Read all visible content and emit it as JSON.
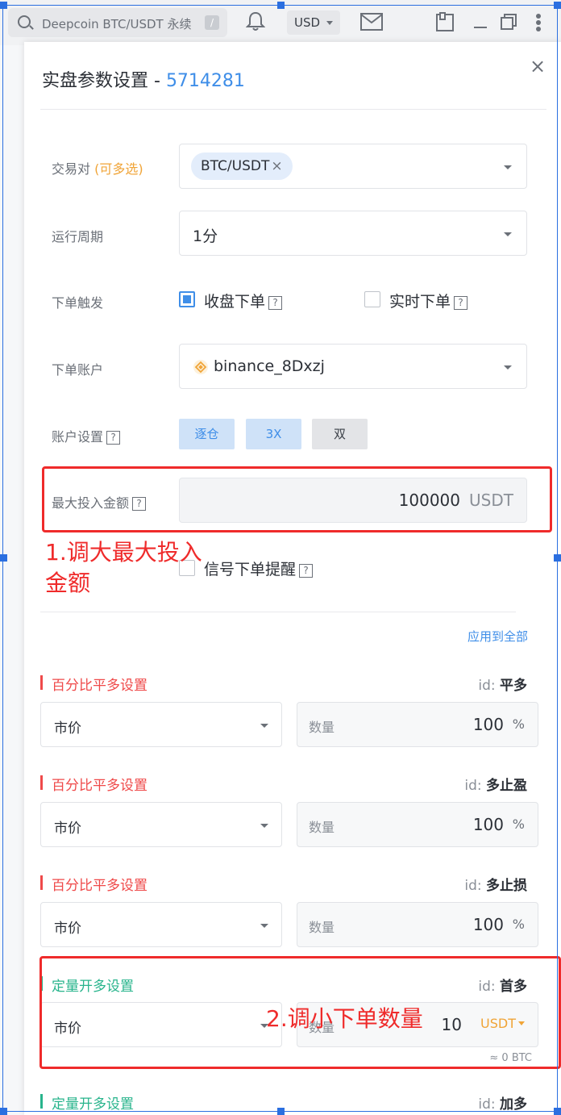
{
  "topbar": {
    "search_text": "Deepcoin BTC/USDT 永续",
    "search_shortcut": "/",
    "currency": "USD"
  },
  "dialog": {
    "title": "实盘参数设置 - ",
    "strategy_id": "5714281",
    "close_label": "×"
  },
  "form": {
    "pair": {
      "label": "交易对 ",
      "hint": "(可多选)",
      "tag": "BTC/USDT",
      "tag_remove": "×"
    },
    "period": {
      "label": "运行周期",
      "value": "1分"
    },
    "trigger": {
      "label": "下单触发",
      "options": [
        {
          "label": "收盘下单",
          "checked": true
        },
        {
          "label": "实时下单",
          "checked": false
        }
      ],
      "help": "?"
    },
    "account": {
      "label": "下单账户",
      "value": "binance_8Dxzj"
    },
    "account_settings": {
      "label": "账户设置",
      "buttons": [
        {
          "label": "逐仓",
          "active": true
        },
        {
          "label": "3X",
          "active": true
        },
        {
          "label": "双",
          "active": false
        }
      ]
    },
    "max_invest": {
      "label": "最大投入金额",
      "value": "100000",
      "unit": "USDT"
    },
    "signal_alert": {
      "label": "信号下单提醒",
      "checked": false
    }
  },
  "annotations": {
    "one_line1": "1.调大最大投入",
    "one_line2": "金额",
    "two": "2.调小下单数量"
  },
  "apply_all": "应用到全部",
  "sections": [
    {
      "title": "百分比平多设置",
      "id_label": "id:",
      "id_value": "平多",
      "order_type": "市价",
      "qty_placeholder": "数量",
      "qty_value": "100",
      "qty_unit": "%",
      "color": "red"
    },
    {
      "title": "百分比平多设置",
      "id_label": "id:",
      "id_value": "多止盈",
      "order_type": "市价",
      "qty_placeholder": "数量",
      "qty_value": "100",
      "qty_unit": "%",
      "color": "red"
    },
    {
      "title": "百分比平多设置",
      "id_label": "id:",
      "id_value": "多止损",
      "order_type": "市价",
      "qty_placeholder": "数量",
      "qty_value": "100",
      "qty_unit": "%",
      "color": "red"
    },
    {
      "title": "定量开多设置",
      "id_label": "id:",
      "id_value": "首多",
      "order_type": "市价",
      "qty_placeholder": "数量",
      "qty_value": "10",
      "qty_unit": "USDT",
      "approx": "≈ 0 BTC",
      "color": "green"
    },
    {
      "title": "定量开多设置",
      "id_label": "id:",
      "id_value": "加多",
      "color": "green"
    }
  ],
  "colors": {
    "accent_blue": "#3f8ee8",
    "annotation_red": "#ef2b2b",
    "section_red": "#ef4a4a",
    "section_green": "#28b48c",
    "usdt_orange": "#f0a437"
  }
}
